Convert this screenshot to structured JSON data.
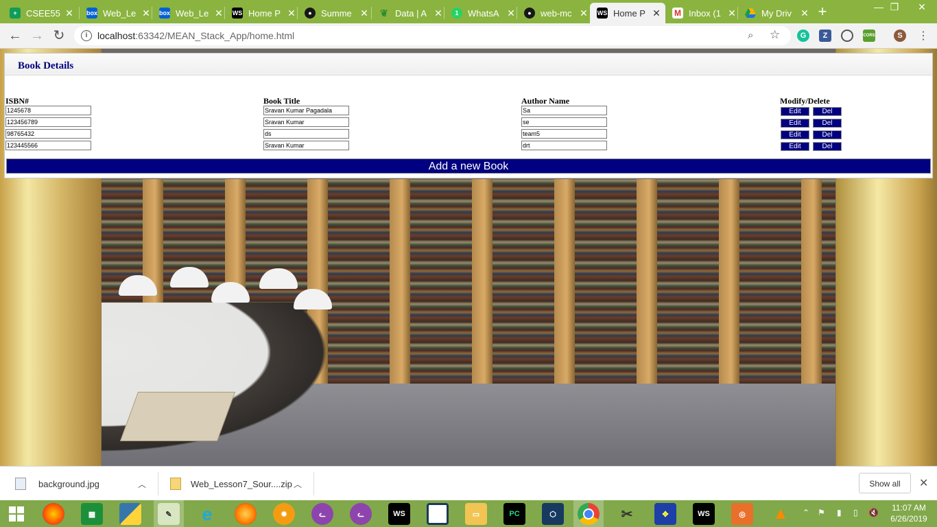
{
  "browser": {
    "tabs": [
      {
        "label": "CSEE55",
        "icon": "sheets-icon",
        "color": "#0f9d58"
      },
      {
        "label": "Web_Le",
        "icon": "box-icon",
        "color": "#0061d5"
      },
      {
        "label": "Web_Le",
        "icon": "box-icon",
        "color": "#0061d5"
      },
      {
        "label": "Home P",
        "icon": "webstorm-icon",
        "color": "#000000"
      },
      {
        "label": "Summe",
        "icon": "github-icon",
        "color": "#181717"
      },
      {
        "label": "Data | A",
        "icon": "mongodb-leaf-icon",
        "color": "#4db33d"
      },
      {
        "label": "WhatsA",
        "icon": "whatsapp-icon",
        "color": "#25d366"
      },
      {
        "label": "web-mc",
        "icon": "github-icon",
        "color": "#181717"
      },
      {
        "label": "Home P",
        "icon": "webstorm-icon",
        "color": "#000000"
      },
      {
        "label": "Inbox (1",
        "icon": "gmail-icon",
        "color": "#d93025"
      },
      {
        "label": "My Driv",
        "icon": "drive-icon",
        "color": "#f4b400"
      }
    ],
    "active_tab_index": 8,
    "whatsapp_badge": "1",
    "webstorm_badge": "WS",
    "box_badge": "box",
    "url_host": "localhost",
    "url_path": ":63342/MEAN_Stack_App/home.html",
    "extensions": {
      "grammarly": "G",
      "zotero": "Z",
      "cors": "CORS",
      "profile": "S"
    },
    "window_controls": {
      "minimize": "—",
      "maximize": "❐",
      "close": "✕"
    }
  },
  "page": {
    "panel_title": "Book Details",
    "columns": {
      "isbn": "ISBN#",
      "title": "Book Title",
      "author": "Author Name",
      "actions": "Modify/Delete"
    },
    "books": [
      {
        "isbn": "1245678",
        "title": "Sravan Kumar Pagadala",
        "author": "Sa"
      },
      {
        "isbn": "123456789",
        "title": "Sravan Kumar",
        "author": "se"
      },
      {
        "isbn": "98765432",
        "title": "ds",
        "author": "team5"
      },
      {
        "isbn": "123445566",
        "title": "Sravan Kumar",
        "author": "drt"
      }
    ],
    "edit_label": "Edit",
    "delete_label": "Del",
    "add_button_label": "Add a new Book",
    "colors": {
      "accent": "#000080"
    }
  },
  "downloads": {
    "items": [
      {
        "name": "background.jpg"
      },
      {
        "name": "Web_Lesson7_Sour....zip"
      }
    ],
    "show_all": "Show all"
  },
  "taskbar": {
    "time": "11:07 AM",
    "date": "6/26/2019",
    "ws_badge": "WS",
    "pc_badge": "PC",
    "apps": [
      "windows-start-icon",
      "firefox-icon",
      "excel-icon",
      "python-icon",
      "notepad-icon",
      "ie-icon",
      "firefox-dev-icon",
      "settings-app-icon",
      "cat-app-icon",
      "cat-app-icon",
      "webstorm-icon",
      "onenote-icon",
      "file-explorer-icon",
      "pycharm-icon",
      "virtualbox-icon",
      "chrome-icon",
      "paint-icon",
      "game-icon",
      "webstorm-icon",
      "screenshot-icon",
      "vlc-icon"
    ]
  }
}
